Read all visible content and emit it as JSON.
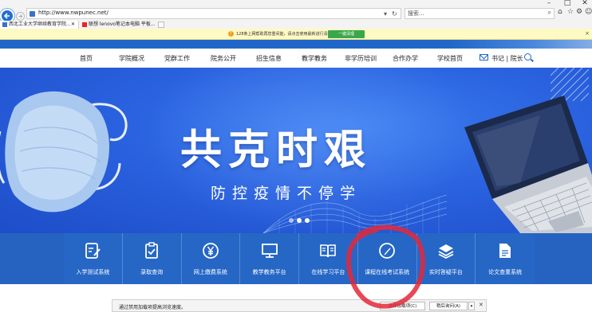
{
  "browser": {
    "url": "http://www.nwpunec.net/",
    "search_placeholder": "搜索...",
    "tabs": [
      {
        "label": "西北工业大学继续教育学院...",
        "active": true
      },
      {
        "label": "联想 lenovo笔记本电脑 平板...",
        "active": false
      }
    ],
    "window_controls": [
      "–",
      "□",
      "✕"
    ],
    "icons": [
      "back-arrow-icon",
      "forward-arrow-icon",
      "refresh-icon",
      "search-icon",
      "home-icon",
      "star-icon",
      "gear-icon",
      "smiley-icon"
    ]
  },
  "infobar": {
    "text": "128条上网帮助再您重间能，请点击使用最新进行清理",
    "button_label": "一键清理",
    "close": "×"
  },
  "site": {
    "nav": [
      "首页",
      "学院概况",
      "党群工作",
      "院务公开",
      "招生信息",
      "教学教务",
      "非学历培训",
      "合作办学",
      "学校首页"
    ],
    "mail_label": "书记 | 院长",
    "accent_color": "#1f66c8"
  },
  "banner": {
    "title": "共克时艰",
    "subtitle": "防控疫情不停学",
    "slide_count": 3,
    "active_slide": 2,
    "background_color": "#2a62df"
  },
  "services": [
    {
      "label": "入学测试系统",
      "icon": "edit-note-icon"
    },
    {
      "label": "录取查询",
      "icon": "clipboard-check-icon"
    },
    {
      "label": "网上缴费系统",
      "icon": "yen-coin-icon"
    },
    {
      "label": "教学教务平台",
      "icon": "monitor-icon"
    },
    {
      "label": "在线学习平台",
      "icon": "open-book-icon"
    },
    {
      "label": "课程在线考试系统",
      "icon": "pencil-circle-icon"
    },
    {
      "label": "实时答疑平台",
      "icon": "layers-icon"
    },
    {
      "label": "论文查重系统",
      "icon": "document-icon"
    }
  ],
  "popup": {
    "text": "通过禁用加载项提高浏览速度。",
    "primary_button": "选择加载项(C)",
    "secondary_button": "稍后询问(A)",
    "dropdown": "▾",
    "close": "✕"
  }
}
